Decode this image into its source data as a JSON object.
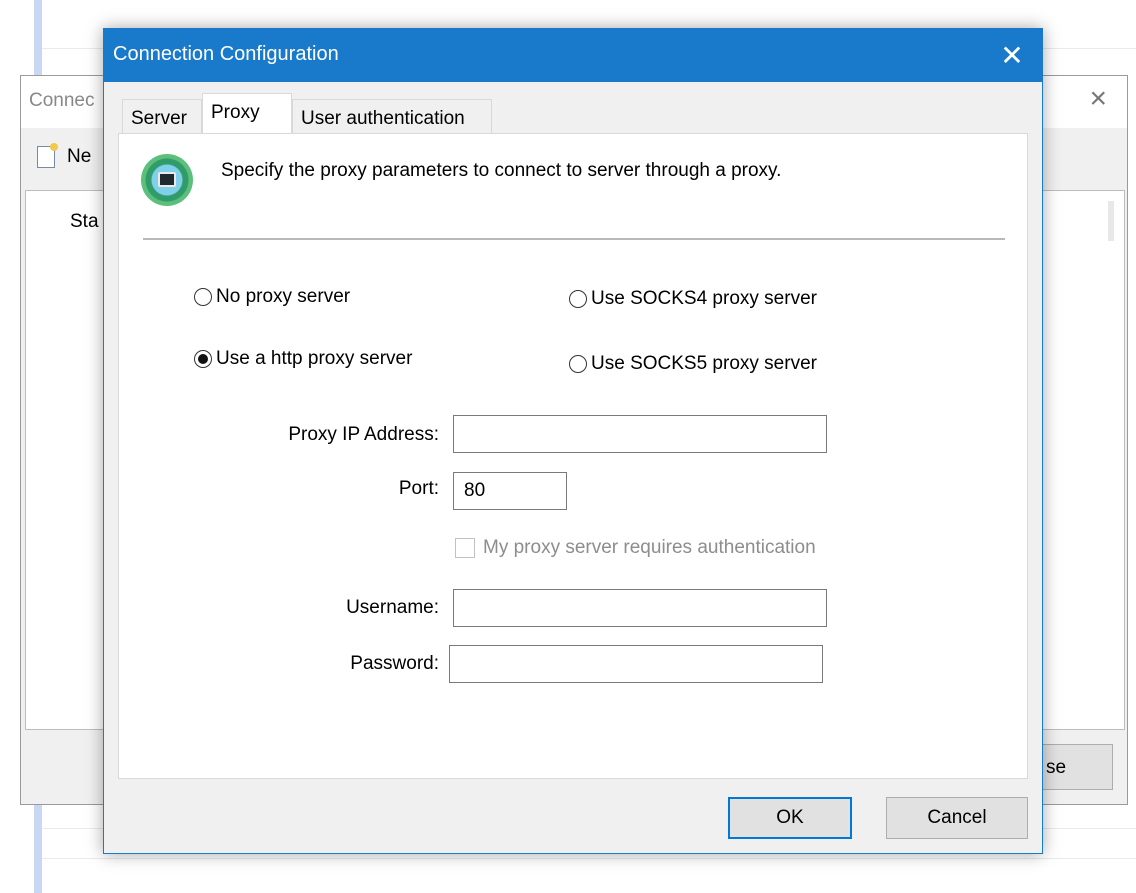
{
  "background_window": {
    "title": "Connec",
    "toolbar_new_label": "Ne",
    "content_text": "Sta",
    "close_button_label": "se"
  },
  "dialog": {
    "title": "Connection Configuration",
    "close_icon": "close-icon",
    "tabs": [
      {
        "label": "Server",
        "active": false
      },
      {
        "label": "Proxy",
        "active": true
      },
      {
        "label": "User authentication",
        "active": false
      }
    ],
    "description": "Specify the proxy parameters to connect to server through a proxy.",
    "icon": "proxy-network-icon",
    "radios": [
      {
        "label": "No proxy server",
        "checked": false
      },
      {
        "label": "Use a http proxy server",
        "checked": true
      },
      {
        "label": "Use SOCKS4 proxy server",
        "checked": false
      },
      {
        "label": "Use SOCKS5 proxy server",
        "checked": false
      }
    ],
    "fields": {
      "proxy_ip_label": "Proxy IP Address:",
      "proxy_ip_value": "",
      "port_label": "Port:",
      "port_value": "80",
      "auth_checkbox_label": "My proxy server requires authentication",
      "auth_checkbox_checked": false,
      "auth_checkbox_enabled": false,
      "username_label": "Username:",
      "username_value": "",
      "password_label": "Password:",
      "password_value": ""
    },
    "buttons": {
      "ok": "OK",
      "cancel": "Cancel"
    },
    "colors": {
      "titlebar": "#1979ca",
      "default_button_border": "#0078d7"
    }
  }
}
